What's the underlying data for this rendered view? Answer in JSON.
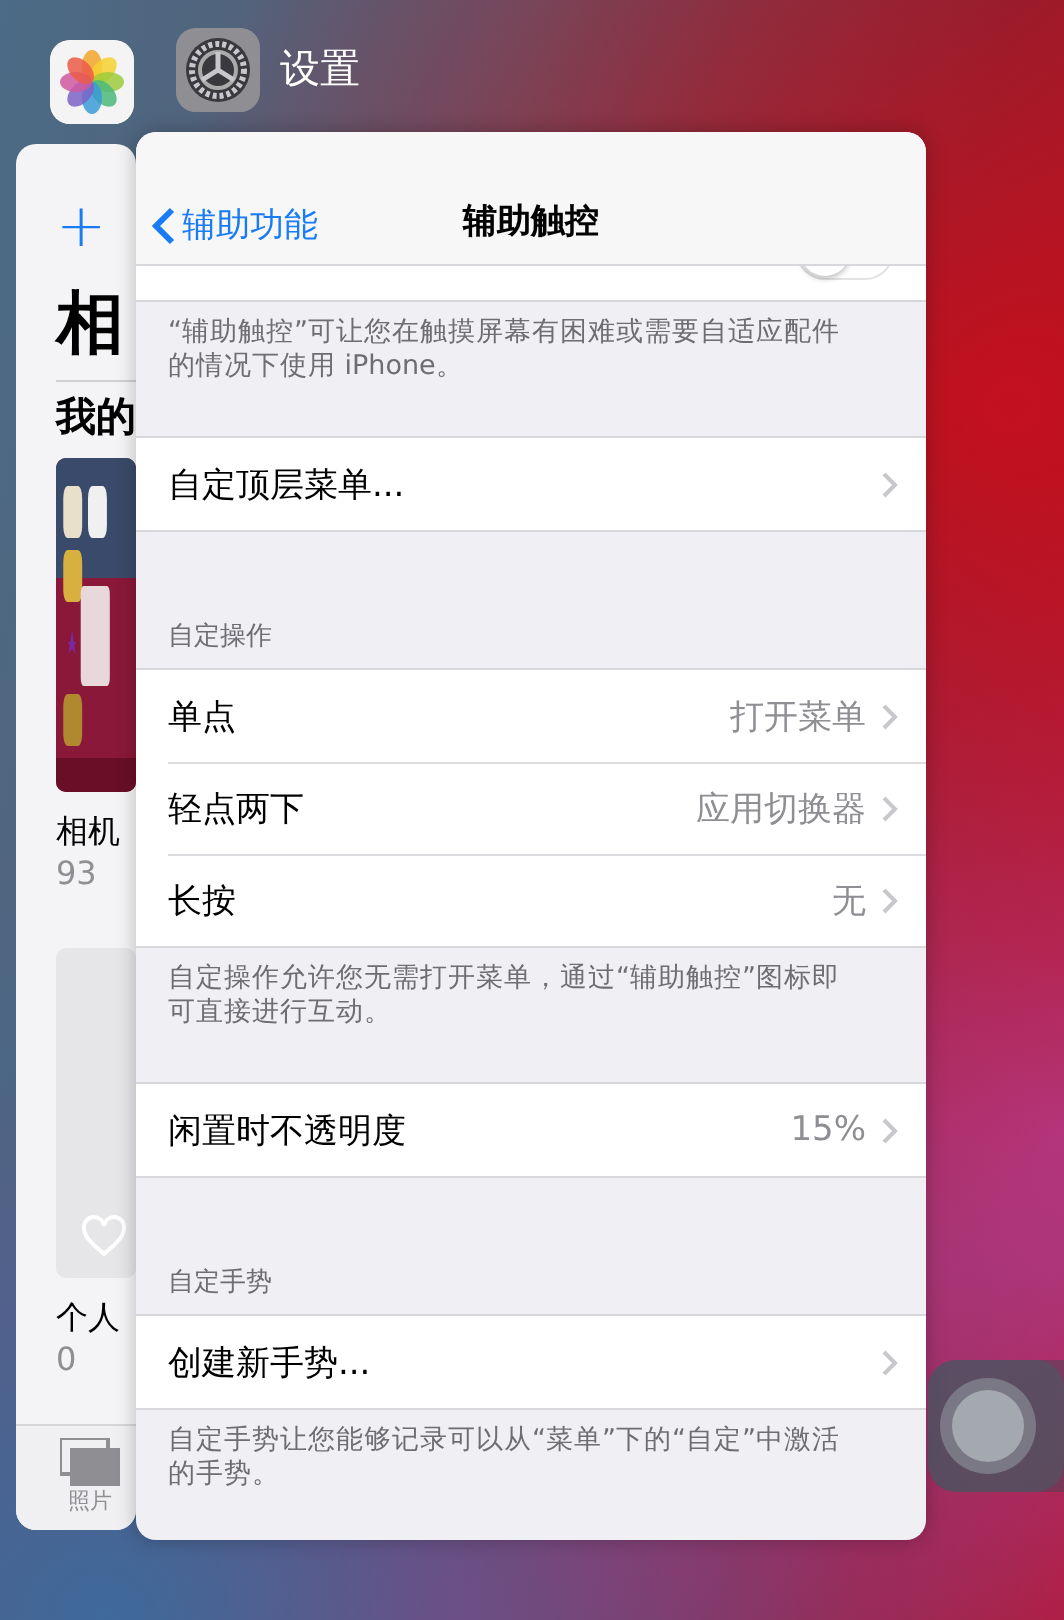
{
  "switcher": {
    "app_label": "设置"
  },
  "photos_card": {
    "add": "+",
    "title": "相",
    "section": "我的",
    "albums": [
      {
        "kind": "picture",
        "name": "相机",
        "count": "93"
      },
      {
        "kind": "favorites",
        "name": "个人",
        "count": "0"
      }
    ],
    "tab": "照片"
  },
  "settings": {
    "back": "辅助功能",
    "title": "辅助触控",
    "toggle": {
      "on": false
    },
    "toggle_footer": "“辅助触控”可让您在触摸屏幕有困难或需要自适应配件的情况下使用 iPhone。",
    "groups": [
      {
        "rows": [
          {
            "label": "自定顶层菜单..."
          }
        ]
      },
      {
        "header": "自定操作",
        "rows": [
          {
            "label": "单点",
            "value": "打开菜单"
          },
          {
            "label": "轻点两下",
            "value": "应用切换器"
          },
          {
            "label": "长按",
            "value": "无"
          }
        ],
        "footer": "自定操作允许您无需打开菜单，通过“辅助触控”图标即可直接进行互动。"
      },
      {
        "rows": [
          {
            "label": "闲置时不透明度",
            "value": "15%"
          }
        ]
      },
      {
        "header": "自定手势",
        "rows": [
          {
            "label": "创建新手势..."
          }
        ],
        "footer": "自定手势让您能够记录可以从“菜单”下的“自定”中激活的手势。"
      }
    ]
  }
}
